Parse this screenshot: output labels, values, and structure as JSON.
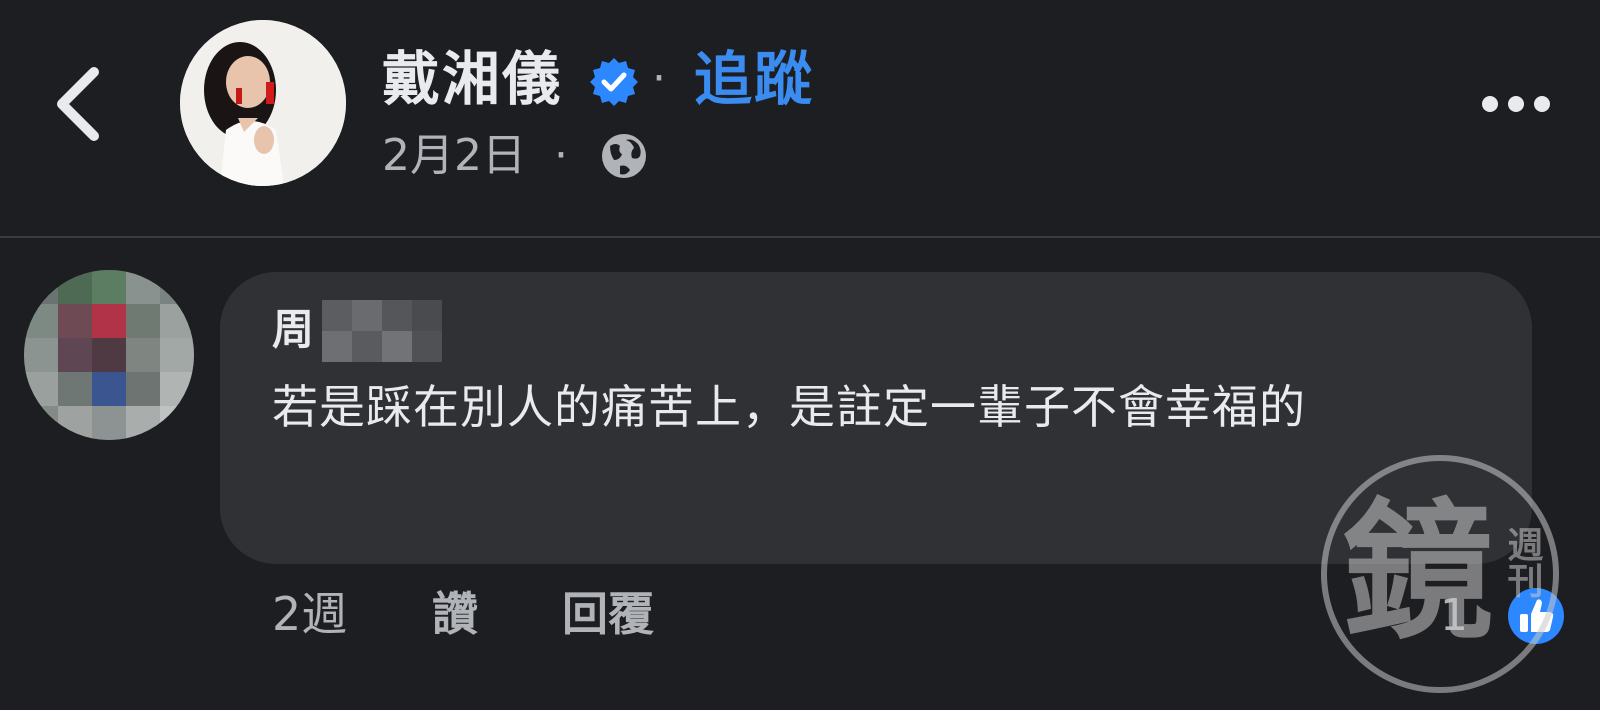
{
  "header": {
    "page_name": "戴湘儀",
    "separator": "·",
    "follow_label": "追蹤",
    "post_date": "2月2日",
    "date_separator": "·",
    "icons": [
      "back-arrow-icon",
      "verified-badge-icon",
      "globe-icon",
      "more-options-icon"
    ]
  },
  "comment": {
    "author_name": "周",
    "author_name_obscured": true,
    "text": "若是踩在別人的痛苦上，是註定一輩子不會幸福的",
    "timestamp": "2週",
    "like_label": "讚",
    "reply_label": "回覆",
    "reaction_count": "1",
    "reaction_icon": "like-reaction-icon"
  },
  "watermark": {
    "text_main": "鏡",
    "text_sub": "週刊"
  },
  "colors": {
    "background": "#1d1e22",
    "bubble": "#303135",
    "accent_blue": "#3b8cf0",
    "text_primary": "#e9eaee",
    "text_secondary": "#b0b3b8"
  }
}
